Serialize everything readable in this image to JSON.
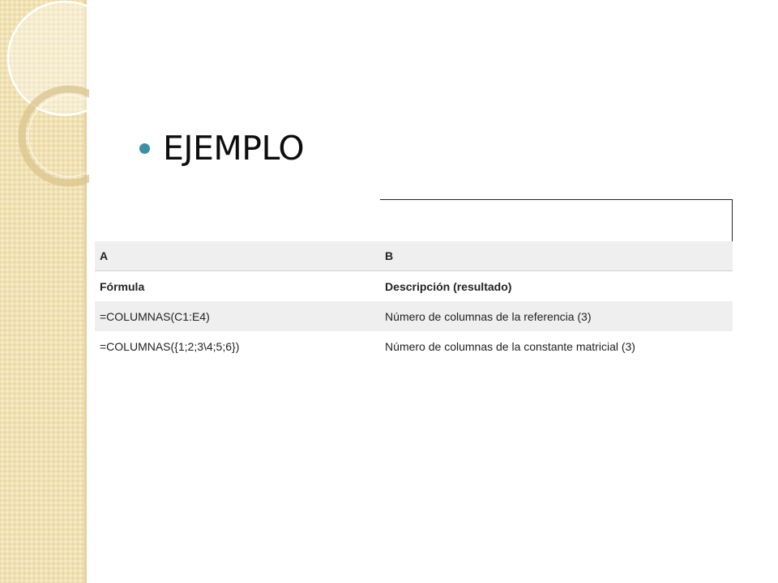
{
  "slide": {
    "title": "EJEMPLO",
    "accent_color": "#3c90a6",
    "band_color": "#f1e2b4"
  },
  "table": {
    "column_headers": [
      "A",
      "B"
    ],
    "rows": [
      [
        "Fórmula",
        "Descripción (resultado)"
      ],
      [
        "=COLUMNAS(C1:E4)",
        "Número de columnas de la referencia (3)"
      ],
      [
        "=COLUMNAS({1;2;3\\4;5;6})",
        "Número de columnas de la constante matricial (3)"
      ]
    ]
  }
}
